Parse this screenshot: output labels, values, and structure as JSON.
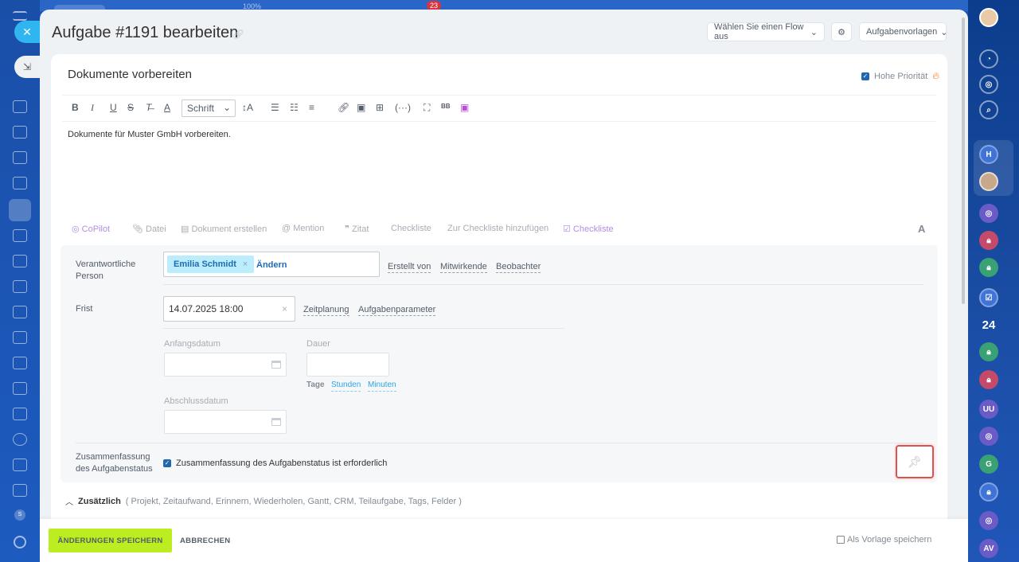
{
  "background": {
    "zoom_label": "100%",
    "counter": "23",
    "left_rail_label": "S"
  },
  "right_rail": {
    "h_label": "H",
    "counter_24": "24",
    "g_label": "G",
    "uu_label": "UU",
    "av_label": "AV"
  },
  "panel": {
    "title": "Aufgabe #1191 bearbeiten",
    "flow_select": "Wählen Sie einen Flow aus",
    "templates_button": "Aufgabenvorlagen"
  },
  "task": {
    "title": "Dokumente vorbereiten",
    "high_priority_label": "Hohe Priorität",
    "font_select": "Schrift",
    "description": "Dokumente für Muster GmbH vorbereiten."
  },
  "attach_bar": {
    "copilot": "CoPilot",
    "file": "Datei",
    "create_doc": "Dokument erstellen",
    "mention": "Mention",
    "quote": "Zitat",
    "checklist": "Checkliste",
    "add_to_checklist": "Zur Checkliste hinzufügen",
    "checklist_new": "Checkliste",
    "font_toggle": "A"
  },
  "fields": {
    "responsible_label": "Verantwortliche Person",
    "responsible_name": "Emilia Schmidt",
    "chip_remove": "×",
    "change_link": "Ändern",
    "created_by": "Erstellt von",
    "participants": "Mitwirkende",
    "observers": "Beobachter",
    "deadline_label": "Frist",
    "deadline_value": "14.07.2025 18:00",
    "deadline_clear": "×",
    "planning": "Zeitplanung",
    "task_params": "Aufgabenparameter",
    "start_date_label": "Anfangsdatum",
    "duration_label": "Dauer",
    "days": "Tage",
    "hours": "Stunden",
    "minutes": "Minuten",
    "end_date_label": "Abschlussdatum",
    "summary_label": "Zusammenfassung des Aufgabenstatus",
    "summary_check": "Zusammenfassung des Aufgabenstatus ist erforderlich"
  },
  "additional": {
    "header": "Zusätzlich",
    "items": "( Projekt,  Zeitaufwand,  Erinnern,  Wiederholen,  Gantt,  CRM,  Teilaufgabe,  Tags,  Felder )"
  },
  "footer": {
    "save": "ÄNDERUNGEN SPEICHERN",
    "cancel": "ABBRECHEN",
    "save_template": "Als Vorlage speichern"
  }
}
